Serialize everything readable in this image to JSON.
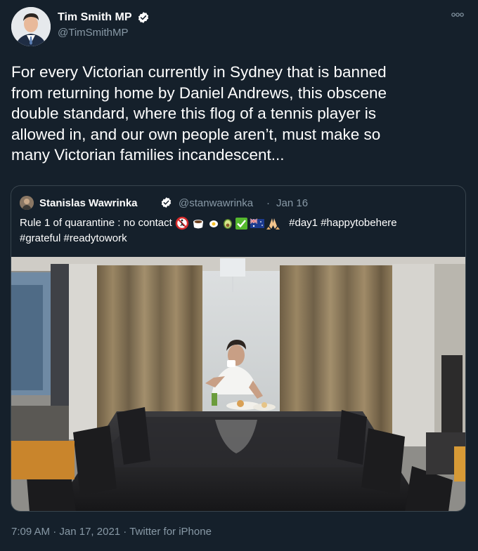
{
  "author": {
    "display_name": "Tim Smith MP",
    "handle": "@TimSmithMP",
    "verified_icon": "verified-badge-icon"
  },
  "tweet": {
    "text": "For every Victorian currently in Sydney that is banned\nfrom returning home by Daniel Andrews, this obscene\ndouble standard, where this flog of a tennis player is\nallowed in, and our own people aren’t, must make so\nmany Victorian families incandescent..."
  },
  "quoted": {
    "display_name": "Stanislas Wawrinka",
    "handle": "@stanwawrinka",
    "separator": "·",
    "date": "Jan 16",
    "text_before": "Rule 1 of quarantine : no contact ",
    "hashtags_line1": "#day1 #happytobehere",
    "hashtags_line2": "#grateful #readytowork",
    "emojis": [
      "no-pedestrians",
      "coffee",
      "fried-egg",
      "avocado",
      "check-mark",
      "australia-flag",
      "folded-hands"
    ]
  },
  "footer": {
    "time": "7:09 AM",
    "sep1": " · ",
    "date": "Jan 17, 2021",
    "sep2": " · ",
    "source": "Twitter for iPhone"
  },
  "colors": {
    "background": "#15202b",
    "secondary_text": "#8899a6",
    "border": "#38444d",
    "verified_blue": "#ffffff"
  }
}
